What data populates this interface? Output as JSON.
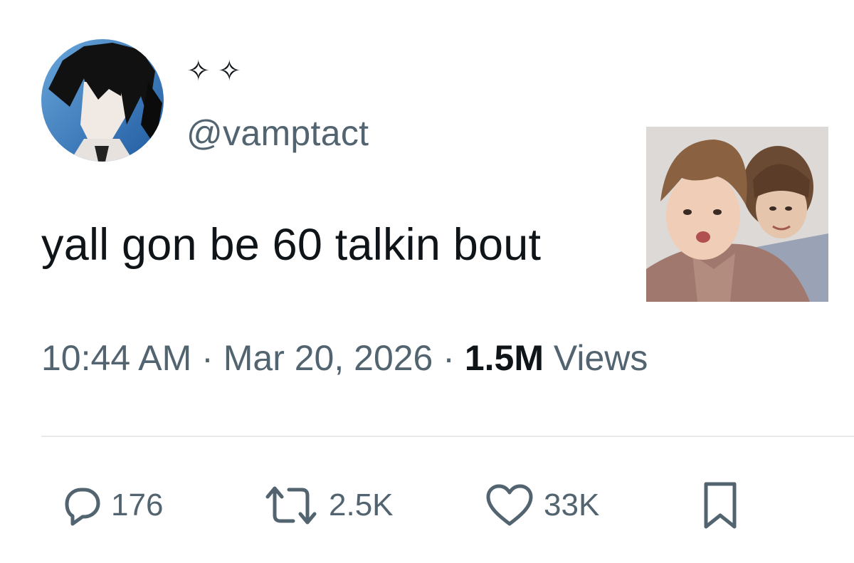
{
  "author": {
    "display_name_icons": [
      "sparkle-icon",
      "sparkle-icon"
    ],
    "handle": "@vamptact"
  },
  "tweet": {
    "text": "yall gon be 60 talkin bout",
    "time": "10:44 AM",
    "date": "Mar 20, 2026",
    "views_count": "1.5M",
    "views_label": "Views",
    "separator": "·"
  },
  "actions": {
    "replies": "176",
    "reposts": "2.5K",
    "likes": "33K"
  },
  "colors": {
    "text_primary": "#0f1419",
    "text_secondary": "#536471",
    "divider": "#e7e9ea"
  }
}
